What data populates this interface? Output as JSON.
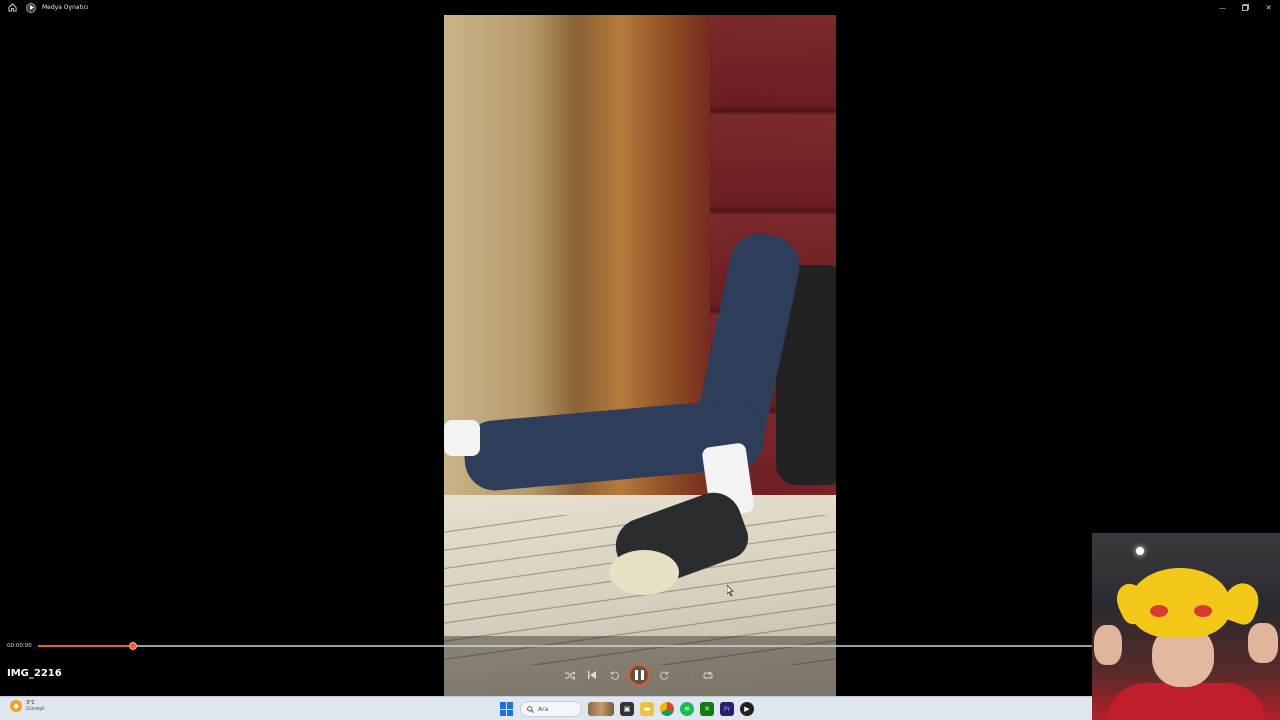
{
  "window": {
    "title": "Medya Oynatıcı"
  },
  "player": {
    "file_name": "IMG_2216",
    "time_current": "00:00:00",
    "progress_fraction": 0.09
  },
  "controls": {
    "shuffle_icon": "shuffle-icon",
    "previous_icon": "skip-previous-icon",
    "rewind_icon": "rewind-10-icon",
    "pause_icon": "pause-icon",
    "forward_icon": "forward-30-icon",
    "next_icon": "skip-next-icon",
    "repeat_icon": "repeat-icon"
  },
  "colors": {
    "accent": "#e8622c",
    "taskbar": "#dfe6f0"
  },
  "taskbar": {
    "weather_temp": "3°C",
    "weather_desc": "Güneşli",
    "search_placeholder": "Ara",
    "apps": [
      "start",
      "search",
      "mascot",
      "task-view",
      "file-explorer",
      "chrome",
      "spotify",
      "xbox",
      "premiere-pro",
      "media-player"
    ]
  }
}
